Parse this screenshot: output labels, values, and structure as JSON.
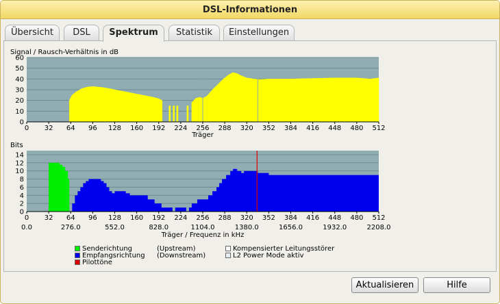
{
  "window": {
    "title": "DSL-Informationen"
  },
  "tabs": [
    {
      "label": "Übersicht",
      "active": false
    },
    {
      "label": "DSL",
      "active": false
    },
    {
      "label": "Spektrum",
      "active": true
    },
    {
      "label": "Statistik",
      "active": false
    },
    {
      "label": "Einstellungen",
      "active": false
    }
  ],
  "chart_data": [
    {
      "type": "area",
      "title": "Signal / Rausch-Verhältnis in dB",
      "xlabel": "Träger",
      "ylabel": "",
      "xlim": [
        0,
        512
      ],
      "ylim": [
        0,
        60
      ],
      "grid": true,
      "x_ticks": [
        "0",
        "32",
        "64",
        "96",
        "128",
        "160",
        "192",
        "224",
        "256",
        "288",
        "320",
        "352",
        "384",
        "416",
        "448",
        "480",
        "512"
      ],
      "y_ticks": [
        "0",
        "10",
        "20",
        "30",
        "40",
        "50",
        "60"
      ],
      "colors": {
        "fill": "#ffff00",
        "plot_bg": "#8fadb2",
        "grid": "#6e8c90"
      },
      "series": [
        {
          "values_points": [
            [
              62,
              0
            ],
            [
              62,
              20
            ],
            [
              66,
              25
            ],
            [
              72,
              28
            ],
            [
              80,
              31
            ],
            [
              88,
              32.5
            ],
            [
              96,
              33
            ],
            [
              104,
              32.5
            ],
            [
              112,
              32
            ],
            [
              120,
              31
            ],
            [
              128,
              30
            ],
            [
              136,
              29
            ],
            [
              144,
              28
            ],
            [
              152,
              27
            ],
            [
              160,
              26
            ],
            [
              168,
              25
            ],
            [
              176,
              24
            ],
            [
              184,
              23
            ],
            [
              190,
              22
            ],
            [
              194,
              21
            ],
            [
              197,
              20
            ],
            [
              197,
              0
            ],
            [
              207,
              0
            ],
            [
              207,
              15
            ],
            [
              209,
              15
            ],
            [
              209,
              0
            ],
            [
              213,
              0
            ],
            [
              213,
              15
            ],
            [
              215,
              15
            ],
            [
              215,
              0
            ],
            [
              218,
              0
            ],
            [
              218,
              15
            ],
            [
              220,
              15
            ],
            [
              220,
              0
            ],
            [
              233,
              0
            ],
            [
              233,
              15
            ],
            [
              235,
              15
            ],
            [
              235,
              0
            ],
            [
              240,
              0
            ],
            [
              240,
              18
            ],
            [
              246,
              22
            ],
            [
              252,
              23
            ],
            [
              256,
              22
            ],
            [
              262,
              24
            ],
            [
              270,
              30
            ],
            [
              278,
              35
            ],
            [
              286,
              40
            ],
            [
              294,
              44
            ],
            [
              300,
              46
            ],
            [
              306,
              45
            ],
            [
              312,
              43
            ],
            [
              320,
              41
            ],
            [
              330,
              40
            ],
            [
              340,
              39.5
            ],
            [
              352,
              40
            ],
            [
              384,
              40
            ],
            [
              416,
              40.5
            ],
            [
              448,
              41
            ],
            [
              480,
              41
            ],
            [
              500,
              40
            ],
            [
              512,
              41
            ],
            [
              512,
              0
            ]
          ],
          "notches_at": [
            336,
            256
          ]
        }
      ]
    },
    {
      "type": "bar",
      "title": "Bits",
      "xlabel": "Träger / Frequenz in kHz",
      "ylabel": "",
      "xlim": [
        0,
        512
      ],
      "ylim": [
        0,
        15
      ],
      "grid": true,
      "x_ticks": [
        "0",
        "32",
        "64",
        "96",
        "128",
        "160",
        "192",
        "224",
        "256",
        "288",
        "320",
        "352",
        "384",
        "416",
        "448",
        "480",
        "512"
      ],
      "x_ticks_khz": [
        "0.0",
        "276.0",
        "552.0",
        "828.0",
        "1104.0",
        "1380.0",
        "1656.0",
        "1932.0",
        "2208.0"
      ],
      "y_ticks": [
        "0",
        "2",
        "4",
        "6",
        "8",
        "10",
        "12",
        "14"
      ],
      "colors": {
        "upstream": "#00ee00",
        "downstream": "#0000ee",
        "pilot": "#dd0000",
        "plot_bg": "#8fadb2",
        "grid": "#6e8c90"
      },
      "series": [
        {
          "name": "Senderichtung",
          "points": [
            [
              32,
              12
            ],
            [
              42,
              12
            ],
            [
              48,
              11.5
            ],
            [
              52,
              11
            ],
            [
              56,
              10
            ],
            [
              60,
              8
            ],
            [
              62,
              0
            ]
          ]
        },
        {
          "name": "Empfangsrichtung",
          "points": [
            [
              62,
              0
            ],
            [
              66,
              2
            ],
            [
              70,
              4
            ],
            [
              74,
              5
            ],
            [
              78,
              6
            ],
            [
              82,
              7
            ],
            [
              86,
              7.5
            ],
            [
              90,
              8
            ],
            [
              100,
              8
            ],
            [
              104,
              8
            ],
            [
              108,
              7.5
            ],
            [
              112,
              7
            ],
            [
              116,
              6
            ],
            [
              120,
              5
            ],
            [
              124,
              4.5
            ],
            [
              128,
              5
            ],
            [
              136,
              5
            ],
            [
              144,
              4.5
            ],
            [
              150,
              4
            ],
            [
              170,
              4
            ],
            [
              176,
              3
            ],
            [
              186,
              2
            ],
            [
              196,
              1
            ],
            [
              204,
              1
            ],
            [
              212,
              0
            ],
            [
              216,
              1
            ],
            [
              224,
              1
            ],
            [
              232,
              0
            ],
            [
              236,
              1
            ],
            [
              240,
              2
            ],
            [
              248,
              3
            ],
            [
              256,
              3
            ],
            [
              264,
              4
            ],
            [
              270,
              5
            ],
            [
              276,
              6
            ],
            [
              280,
              7
            ],
            [
              284,
              8
            ],
            [
              290,
              9
            ],
            [
              296,
              10
            ],
            [
              300,
              10.5
            ],
            [
              306,
              10
            ],
            [
              312,
              9.5
            ],
            [
              316,
              10
            ],
            [
              320,
              10
            ],
            [
              336,
              9.5
            ],
            [
              352,
              9
            ],
            [
              384,
              9
            ],
            [
              416,
              9
            ],
            [
              448,
              9
            ],
            [
              480,
              9
            ],
            [
              512,
              9
            ]
          ]
        }
      ],
      "pilot_tones": [
        335
      ]
    }
  ],
  "legend": {
    "upstream_label": "Senderichtung",
    "upstream_dir": "(Upstream)",
    "downstream_label": "Empfangsrichtung",
    "downstream_dir": "(Downstream)",
    "pilot_label": "Pilottöne",
    "crosstalk_label": "Kompensierter Leitungsstörer",
    "l2_label": "L2 Power Mode aktiv"
  },
  "buttons": {
    "refresh": "Aktualisieren",
    "help": "Hilfe"
  }
}
